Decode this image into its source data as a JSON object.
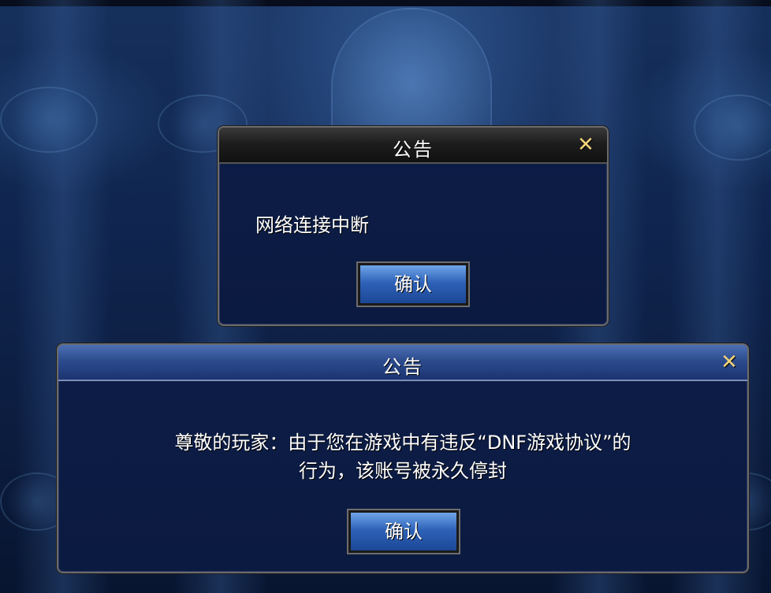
{
  "dialog_network": {
    "title": "公告",
    "close_icon": "close-icon",
    "message": "网络连接中断",
    "confirm_label": "确认"
  },
  "dialog_ban": {
    "title": "公告",
    "close_icon": "close-icon",
    "message_line1": "尊敬的玩家：由于您在游戏中有违反“DNF游戏协议”的",
    "message_line2": "行为，该账号被永久停封",
    "confirm_label": "确认"
  },
  "colors": {
    "background": "#0b1a38",
    "title_text": "#ffffff",
    "close_icon": "#f2d27a",
    "button": "#2e62b8"
  }
}
